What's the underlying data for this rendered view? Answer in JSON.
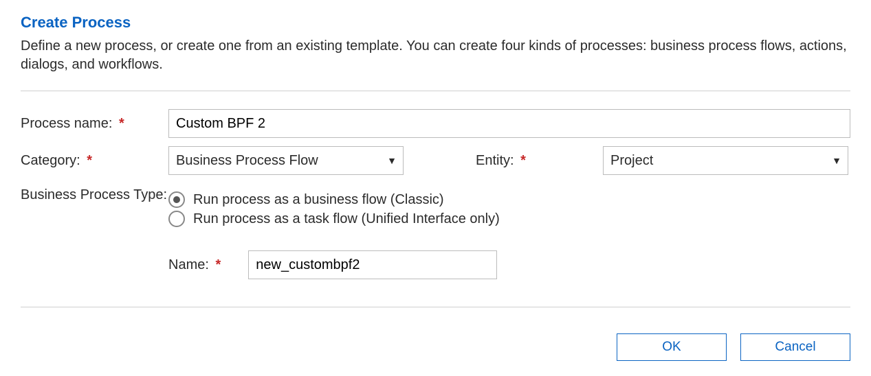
{
  "title": "Create Process",
  "subtitle": "Define a new process, or create one from an existing template. You can create four kinds of processes: business process flows, actions, dialogs, and workflows.",
  "labels": {
    "process_name": "Process name:",
    "category": "Category:",
    "entity": "Entity:",
    "bpt": "Business Process Type:",
    "name": "Name:"
  },
  "fields": {
    "process_name": "Custom BPF 2",
    "category": "Business Process Flow",
    "entity": "Project",
    "bpt_option1": "Run process as a business flow (Classic)",
    "bpt_option2": "Run process as a task flow (Unified Interface only)",
    "bpt_selected": 0,
    "name": "new_custombpf2"
  },
  "buttons": {
    "ok": "OK",
    "cancel": "Cancel"
  }
}
